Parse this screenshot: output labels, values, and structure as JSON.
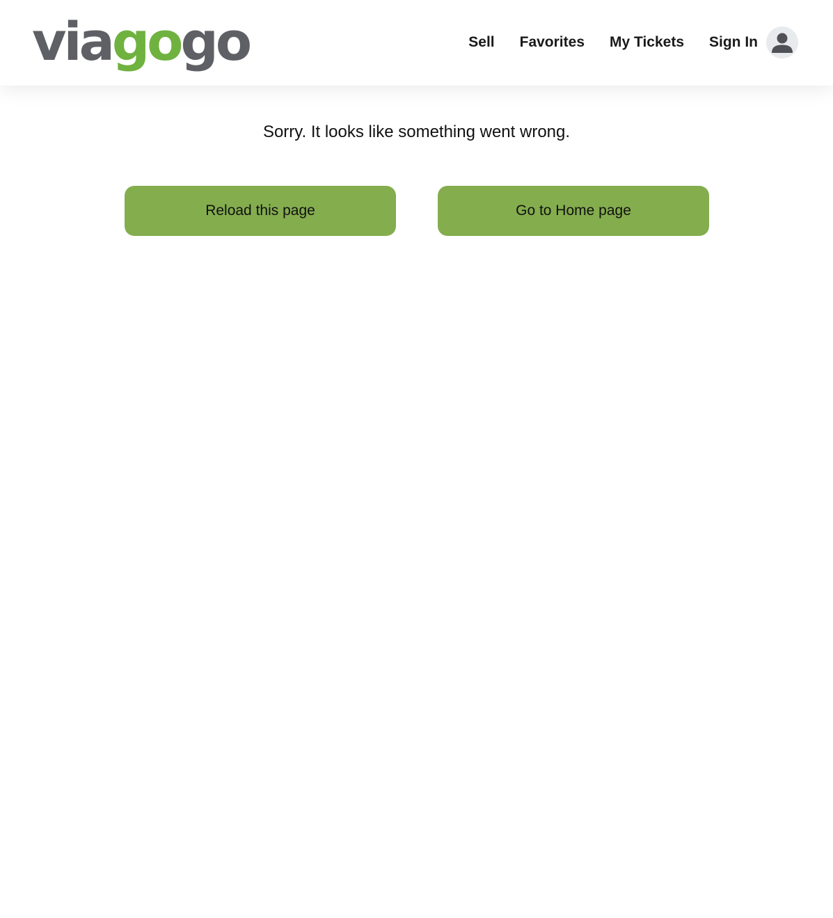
{
  "header": {
    "logo": {
      "part1": "via",
      "part2": "go",
      "part3": "go",
      "colors": {
        "grey": "#5f6065",
        "green": "#6fb23f"
      }
    },
    "nav": {
      "sell": "Sell",
      "favorites": "Favorites",
      "my_tickets": "My Tickets",
      "sign_in": "Sign In"
    },
    "avatar_icon": "user-icon"
  },
  "main": {
    "message": "Sorry. It looks like something went wrong.",
    "reload_button": "Reload this page",
    "home_button": "Go to Home page",
    "button_color": "#84ad4e"
  }
}
